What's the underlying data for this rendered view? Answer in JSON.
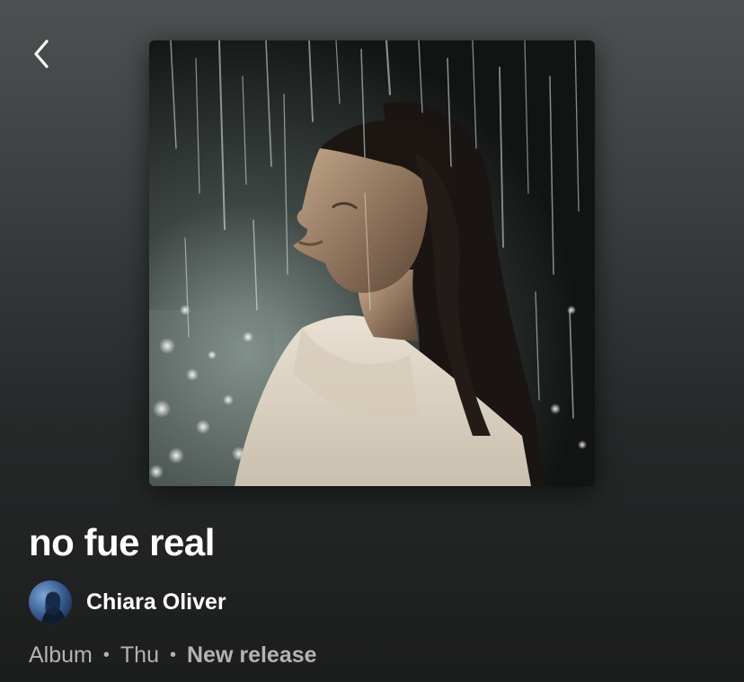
{
  "nav": {
    "back_icon": "chevron-left-icon"
  },
  "album": {
    "title": "no fue real",
    "artist": "Chiara Oliver",
    "type": "Album",
    "release_day": "Thu",
    "badge": "New release",
    "separator": "•"
  },
  "colors": {
    "text_primary": "#ffffff",
    "text_secondary": "#b3b3b3",
    "background_top": "#4d5152",
    "background_bottom": "#1c1d1d"
  }
}
